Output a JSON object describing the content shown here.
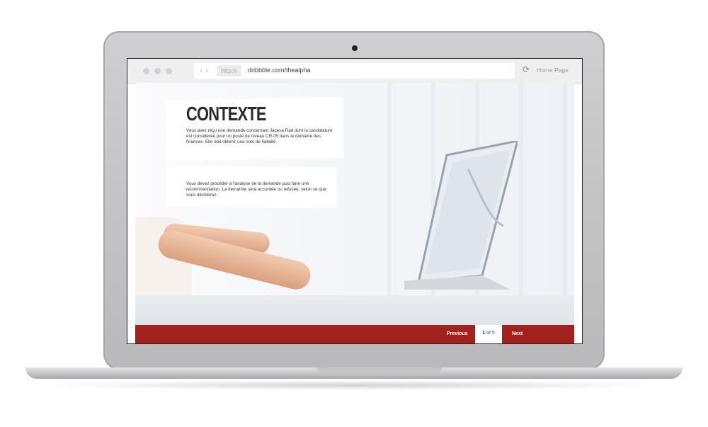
{
  "browser": {
    "nav_arrows": "‹ ›",
    "protocol": "http://",
    "url": "dribbble.com/thealpha",
    "reload_icon": "⟳",
    "home_link": "Home Page"
  },
  "slide": {
    "title": "CONTEXTE",
    "paragraph_1": "Vous avez reçu une demande concernant Jacesa Rad dont la candidature est considérée pour un poste de niveau CR-05 dans le domaine des finances. Elle doit obtenir une cote de fiabilité.",
    "paragraph_2": "Vous devez procéder à l'analyse de la demande puis faire une recommandation. La demande sera accordée ou refusée, selon ce que vous déciderez."
  },
  "footer": {
    "previous_label": "Previous",
    "current_page": "1",
    "of_label": "of",
    "total_pages": "5",
    "next_label": "Next",
    "accent_color": "#a2211f"
  }
}
